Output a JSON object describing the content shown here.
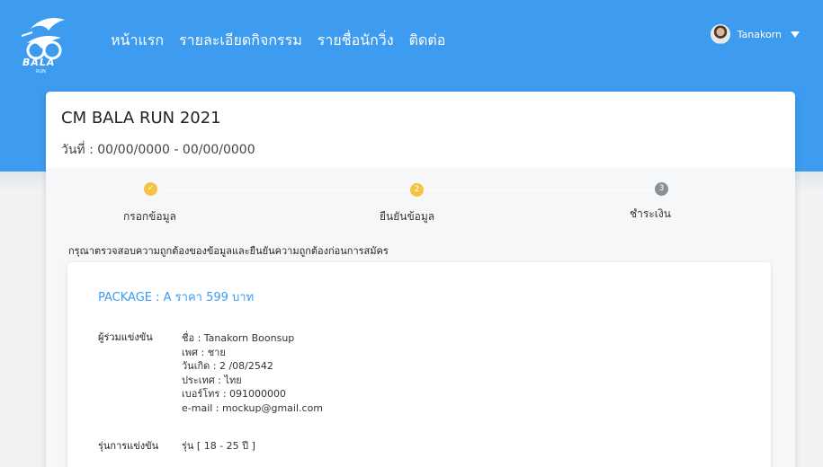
{
  "header": {
    "logo_text": "BALA",
    "logo_sub": "RUN",
    "nav": [
      "หน้าแรก",
      "รายละเอียดกิจกรรม",
      "รายชื่อนักวิ่ง",
      "ติดต่อ"
    ],
    "user_name": "Tanakorn",
    "accent": "#3d9bf0"
  },
  "event": {
    "title": "CM BALA RUN 2021",
    "date": "วันที่ : 00/00/0000 - 00/00/0000"
  },
  "steps": [
    {
      "marker": "✓",
      "label": "กรอกข้อมูล",
      "color": "#f5c242"
    },
    {
      "marker": "2",
      "label": "ยืนยันข้อมูล",
      "color": "#f5c242"
    },
    {
      "marker": "3",
      "label": "ชำระเงิน",
      "color": "#8a8f96"
    }
  ],
  "instruction": "กรุณาตรวจสอบความถูกต้องของข้อมูลและยืนยันความถูกต้องก่อนการสมัคร",
  "package": "PACKAGE : A ราคา 599 บาท",
  "participant": {
    "label": "ผู้ร่วมแข่งขัน",
    "lines": [
      "ชื่อ  : Tanakorn Boonsup",
      "เพศ : ชาย",
      "วันเกิด : 2 /08/2542",
      "ประเทศ : ไทย",
      "เบอร์โทร : 091000000",
      "e-mail :  mockup@gmail.com"
    ]
  },
  "division": {
    "label": "รุ่นการแข่งขัน",
    "value": "รุ่น [ 18 - 25 ปี ]"
  }
}
